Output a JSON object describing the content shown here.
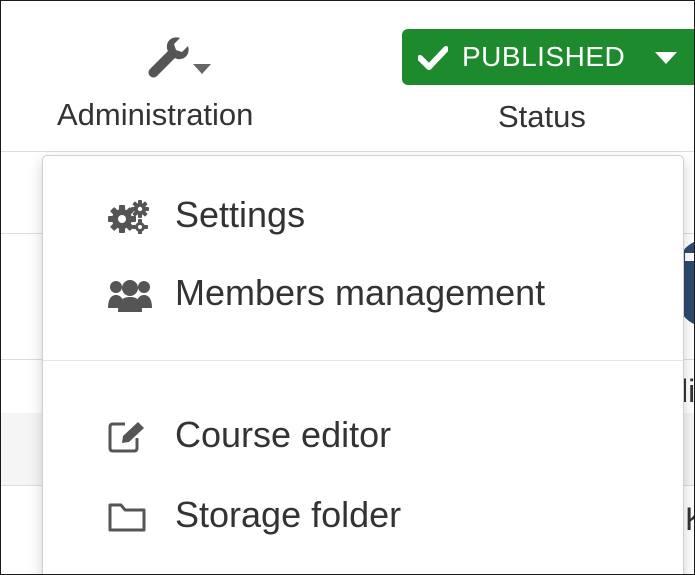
{
  "toolbar": {
    "administration": {
      "label": "Administration",
      "icon": "wrench-icon"
    },
    "status": {
      "badge_text": "PUBLISHED",
      "label": "Status",
      "badge_color": "#1e8a2e"
    }
  },
  "dropdown": {
    "items": [
      {
        "label": "Settings",
        "icon": "gears-icon"
      },
      {
        "label": "Members management",
        "icon": "users-icon"
      },
      {
        "label": "Course editor",
        "icon": "edit-icon"
      },
      {
        "label": "Storage folder",
        "icon": "folder-icon"
      }
    ]
  },
  "background": {
    "fragment_1": "li",
    "fragment_2": "K"
  }
}
